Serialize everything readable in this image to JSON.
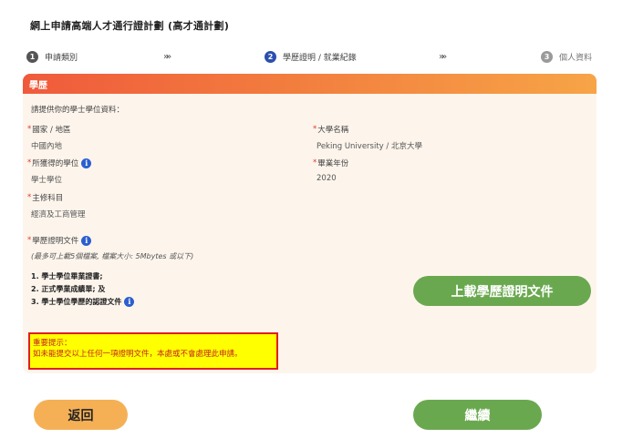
{
  "page": {
    "title": "網上申請高端人才通行證計劃 (高才通計劃)"
  },
  "steps": [
    {
      "num": "1",
      "label": "申請類別",
      "state": "done"
    },
    {
      "num": "2",
      "label": "學歷證明 / 就業紀錄",
      "state": "active"
    },
    {
      "num": "3",
      "label": "個人資料",
      "state": "todo"
    }
  ],
  "step_arrow": "»»",
  "section": {
    "header": "學歷",
    "intro": "請提供你的學士學位資料：",
    "fields": {
      "country": {
        "label": "國家 / 地區",
        "value": "中國內地"
      },
      "university": {
        "label": "大學名稱",
        "value": "Peking University / 北京大學"
      },
      "degree": {
        "label": "所獲得的學位",
        "value": "學士學位"
      },
      "graduation_year": {
        "label": "畢業年份",
        "value": "2020"
      },
      "major": {
        "label": "主修科目",
        "value": "經濟及工商管理"
      }
    },
    "proof": {
      "label": "學歷證明文件",
      "hint": "(最多可上載5個檔案, 檔案大小: 5Mbytes 或以下)",
      "items": [
        "1. 學士學位畢業證書;",
        "2. 正式學業成績單; 及",
        "3. 學士學位學歷的認證文件"
      ]
    },
    "upload_label": "上載學歷證明文件",
    "notice": {
      "title": "重要提示：",
      "text": "如未能提交以上任何一項證明文件，本處或不會處理此申請。"
    }
  },
  "buttons": {
    "back": "返回",
    "next": "繼續"
  },
  "required_mark": "*",
  "info_glyph": "i",
  "colors": {
    "header_start": "#f05a3c",
    "header_end": "#f7a447",
    "green": "#6aa84f",
    "orange": "#f5b056",
    "notice_bg": "#ffff00",
    "notice_border": "#e01e1e"
  }
}
